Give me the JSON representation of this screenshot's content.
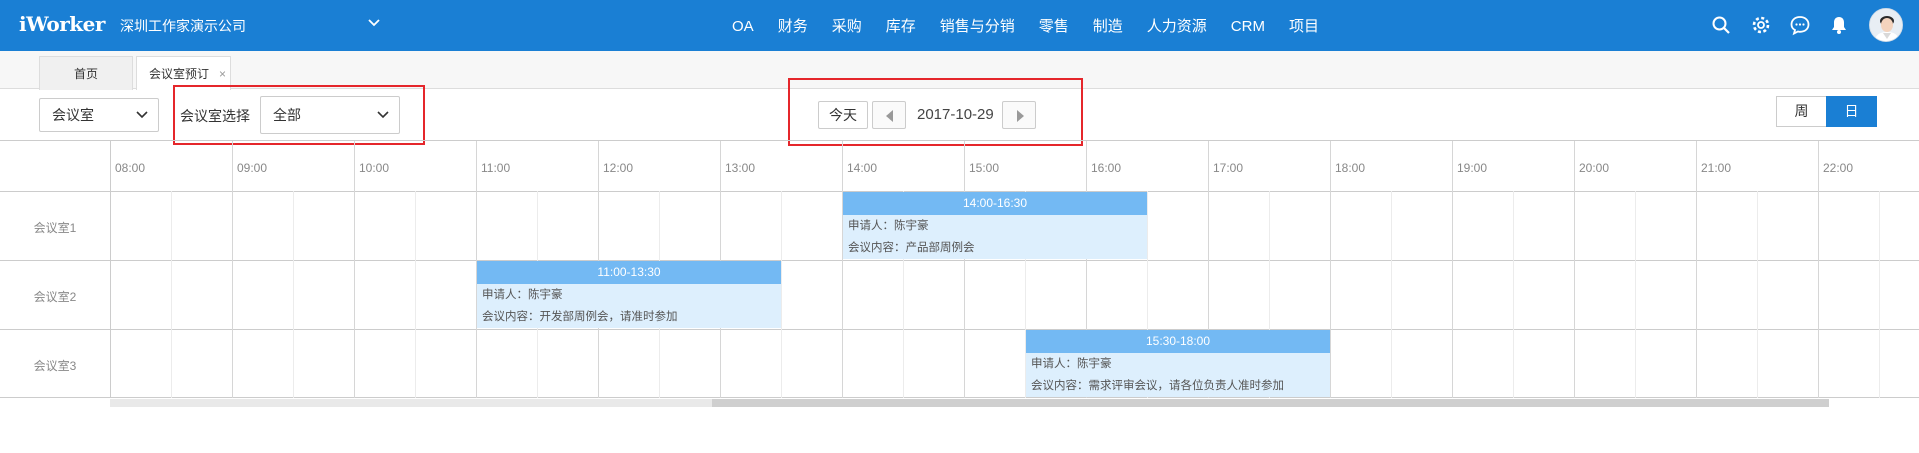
{
  "header": {
    "logo": "iWorker",
    "company": "深圳工作家演示公司",
    "nav": [
      "OA",
      "财务",
      "采购",
      "库存",
      "销售与分销",
      "零售",
      "制造",
      "人力资源",
      "CRM",
      "项目"
    ],
    "icons": [
      "search-icon",
      "gear-icon",
      "chat-icon",
      "bell-icon",
      "avatar"
    ],
    "brand_color": "#1a7fd4"
  },
  "tabs": [
    {
      "label": "首页",
      "active": false
    },
    {
      "label": "会议室预订",
      "active": true,
      "close": "×"
    }
  ],
  "toolbar": {
    "type_select": "会议室",
    "room_select_label": "会议室选择",
    "room_select_value": "全部",
    "today_label": "今天",
    "date": "2017-10-29",
    "view_week": "周",
    "view_day": "日",
    "active_view": "日",
    "highlight_color": "#e5262b"
  },
  "schedule": {
    "hours": [
      "08:00",
      "09:00",
      "10:00",
      "11:00",
      "12:00",
      "13:00",
      "14:00",
      "15:00",
      "16:00",
      "17:00",
      "18:00",
      "19:00",
      "20:00",
      "21:00",
      "22:00"
    ],
    "rooms": [
      "会议室1",
      "会议室2",
      "会议室3"
    ],
    "bookings": [
      {
        "room_index": 0,
        "start": "14:00",
        "end": "16:30",
        "time": "14:00-16:30",
        "applicant": "申请人：陈宇豪",
        "content": "会议内容：产品部周例会"
      },
      {
        "room_index": 1,
        "start": "11:00",
        "end": "13:30",
        "time": "11:00-13:30",
        "applicant": "申请人：陈宇豪",
        "content": "会议内容：开发部周例会，请准时参加"
      },
      {
        "room_index": 2,
        "start": "15:30",
        "end": "18:00",
        "time": "15:30-18:00",
        "applicant": "申请人：陈宇豪",
        "content": "会议内容：需求评审会议，请各位负责人准时参加"
      }
    ],
    "booking_header_color": "#73b9f3",
    "booking_body_color": "#ddeffd"
  }
}
